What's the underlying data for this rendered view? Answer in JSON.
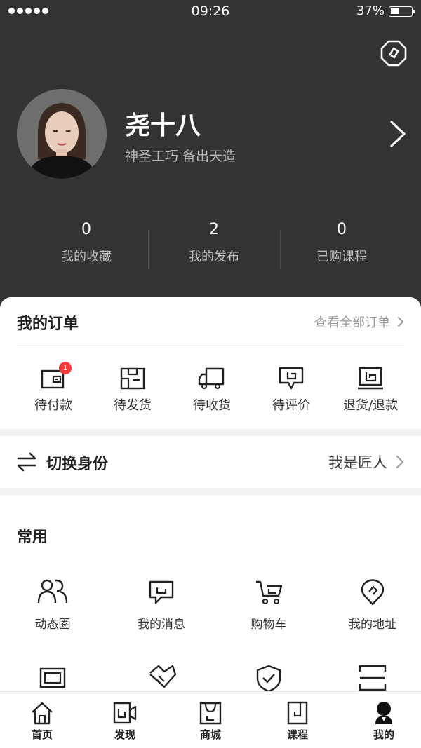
{
  "status_bar": {
    "time": "09:26",
    "battery": "37%"
  },
  "profile": {
    "name": "尧十八",
    "bio": "神圣工巧 备出天造"
  },
  "stats": [
    {
      "value": "0",
      "label": "我的收藏"
    },
    {
      "value": "2",
      "label": "我的发布"
    },
    {
      "value": "0",
      "label": "已购课程"
    }
  ],
  "orders": {
    "title": "我的订单",
    "view_all": "查看全部订单",
    "items": [
      {
        "label": "待付款",
        "badge": "1",
        "icon": "wallet-icon"
      },
      {
        "label": "待发货",
        "icon": "box-icon"
      },
      {
        "label": "待收货",
        "icon": "truck-icon"
      },
      {
        "label": "待评价",
        "icon": "comment-icon"
      },
      {
        "label": "退货/退款",
        "icon": "refund-icon"
      }
    ]
  },
  "switch_identity": {
    "title": "切换身份",
    "role": "我是匠人"
  },
  "common": {
    "title": "常用",
    "items": [
      {
        "label": "动态圈",
        "icon": "people-icon"
      },
      {
        "label": "我的消息",
        "icon": "message-icon"
      },
      {
        "label": "购物车",
        "icon": "cart-icon"
      },
      {
        "label": "我的地址",
        "icon": "location-icon"
      }
    ]
  },
  "tabs": [
    {
      "label": "首页",
      "icon": "home-icon"
    },
    {
      "label": "发现",
      "icon": "video-icon"
    },
    {
      "label": "商城",
      "icon": "shop-icon"
    },
    {
      "label": "课程",
      "icon": "course-icon"
    },
    {
      "label": "我的",
      "icon": "user-icon",
      "active": true
    }
  ]
}
